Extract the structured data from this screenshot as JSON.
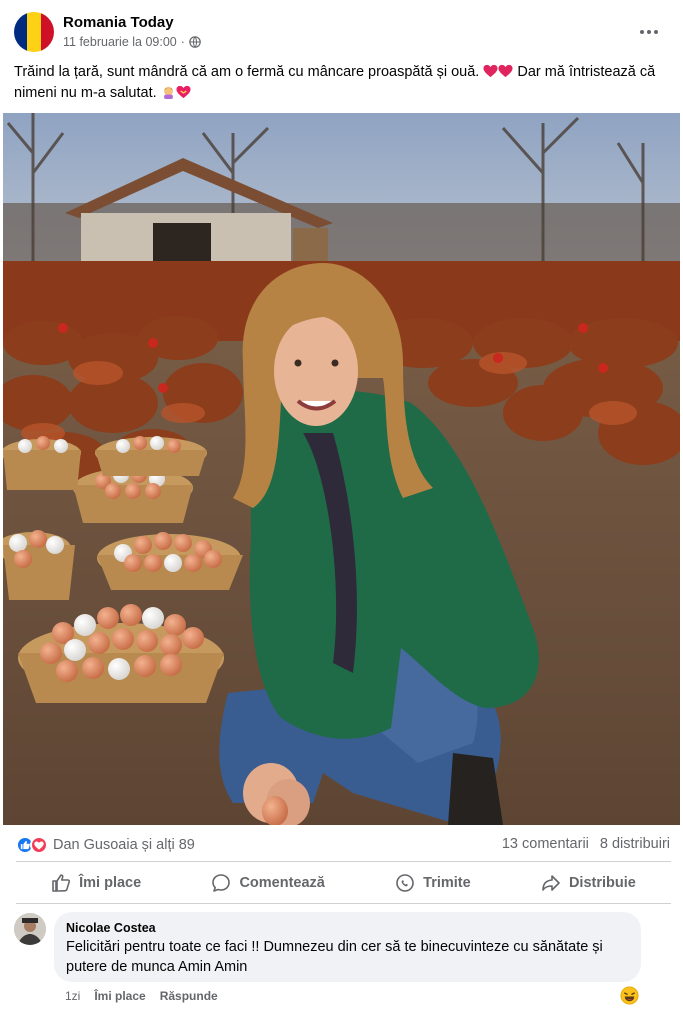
{
  "post": {
    "page_name": "Romania Today",
    "timestamp": "11 februarie la 09:00",
    "privacy_icon": "globe-icon",
    "text_line1": "Trăind la țară, sunt mândră că am o fermă cu mâncare proaspătă și ouă.",
    "text_line1_end": "Dar mă întristează că",
    "text_line2": "nimeni nu m-a salutat.",
    "flag_colors": [
      "#002b7f",
      "#fcd116",
      "#ce1126"
    ]
  },
  "reactions": {
    "summary": "Dan Gusoaia și alți 89",
    "comments": "13 comentarii",
    "shares": "8 distribuiri",
    "like_color": "#1877f2",
    "love_color": "#f33e58"
  },
  "actions": {
    "like": "Îmi place",
    "comment": "Comentează",
    "send": "Trimite",
    "share": "Distribuie"
  },
  "comment": {
    "author": "Nicolae Costea",
    "text_line1": "Felicitări pentru toate ce faci !! Dumnezeu din cer să te binecuvinteze cu sănătate și",
    "text_line2": "putere de munca Amin Amin",
    "age": "1zi",
    "like": "Îmi place",
    "reply": "Răspunde",
    "reaction_icon": "laughing-emoji-icon"
  }
}
